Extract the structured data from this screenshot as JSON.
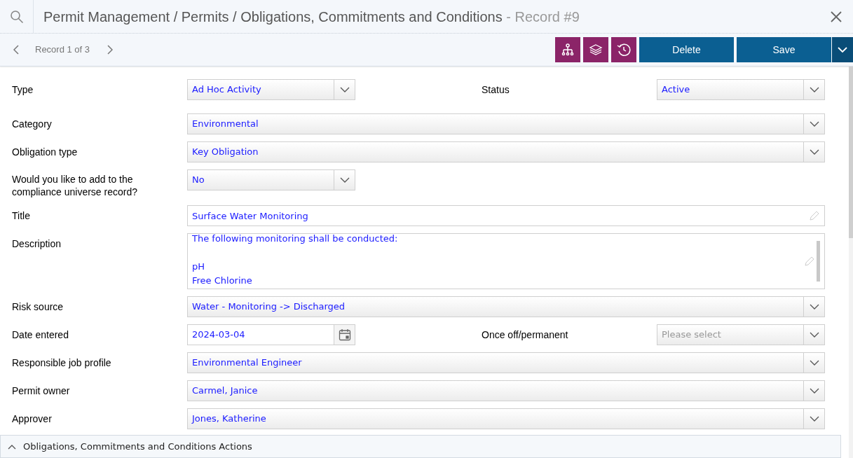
{
  "header": {
    "title": "Permit Management / Permits / Obligations, Commitments and Conditions",
    "record": " - Record #9"
  },
  "toolbar": {
    "record_counter": "Record 1 of 3",
    "buttons": [
      {
        "kind": "delete",
        "label": "Delete"
      },
      {
        "kind": "save",
        "label": "Save"
      }
    ]
  },
  "rows": [
    {
      "kind": "pair",
      "fields": [
        {
          "label": "Type",
          "kind": "select",
          "value": "Ad Hoc Activity"
        },
        {
          "label": "Status",
          "kind": "select",
          "value": "Active"
        }
      ]
    },
    {
      "kind": "full",
      "fields": [
        {
          "label": "Category",
          "kind": "select",
          "value": "Environmental"
        }
      ]
    },
    {
      "kind": "full",
      "fields": [
        {
          "label": "Obligation type",
          "kind": "select",
          "value": "Key Obligation"
        }
      ]
    },
    {
      "kind": "half",
      "fields": [
        {
          "label": "Would you like to add to the compliance universe record?",
          "kind": "select",
          "value": "No"
        }
      ]
    },
    {
      "kind": "full",
      "fields": [
        {
          "label": "Title",
          "kind": "text",
          "value": "Surface Water Monitoring"
        }
      ]
    },
    {
      "kind": "full",
      "fields": [
        {
          "label": "Description",
          "kind": "textarea",
          "value": "The following monitoring shall be conducted:\n\npH\nFree Chlorine"
        }
      ]
    },
    {
      "kind": "full",
      "fields": [
        {
          "label": "Risk source",
          "kind": "select",
          "value": "Water - Monitoring -> Discharged"
        }
      ]
    },
    {
      "kind": "pair",
      "fields": [
        {
          "label": "Date entered",
          "kind": "date",
          "value": "2024-03-04"
        },
        {
          "label": "Once off/permanent",
          "kind": "select",
          "placeholder": "Please select"
        }
      ]
    },
    {
      "kind": "full",
      "fields": [
        {
          "label": "Responsible job profile",
          "kind": "select",
          "value": "Environmental Engineer"
        }
      ]
    },
    {
      "kind": "full",
      "fields": [
        {
          "label": "Permit owner",
          "kind": "select",
          "value": "Carmel, Janice"
        }
      ]
    },
    {
      "kind": "full",
      "fields": [
        {
          "label": "Approver",
          "kind": "select",
          "value": "Jones, Katherine"
        }
      ]
    }
  ],
  "section": {
    "title": "Obligations, Commitments and Conditions Actions",
    "expanded": true
  }
}
